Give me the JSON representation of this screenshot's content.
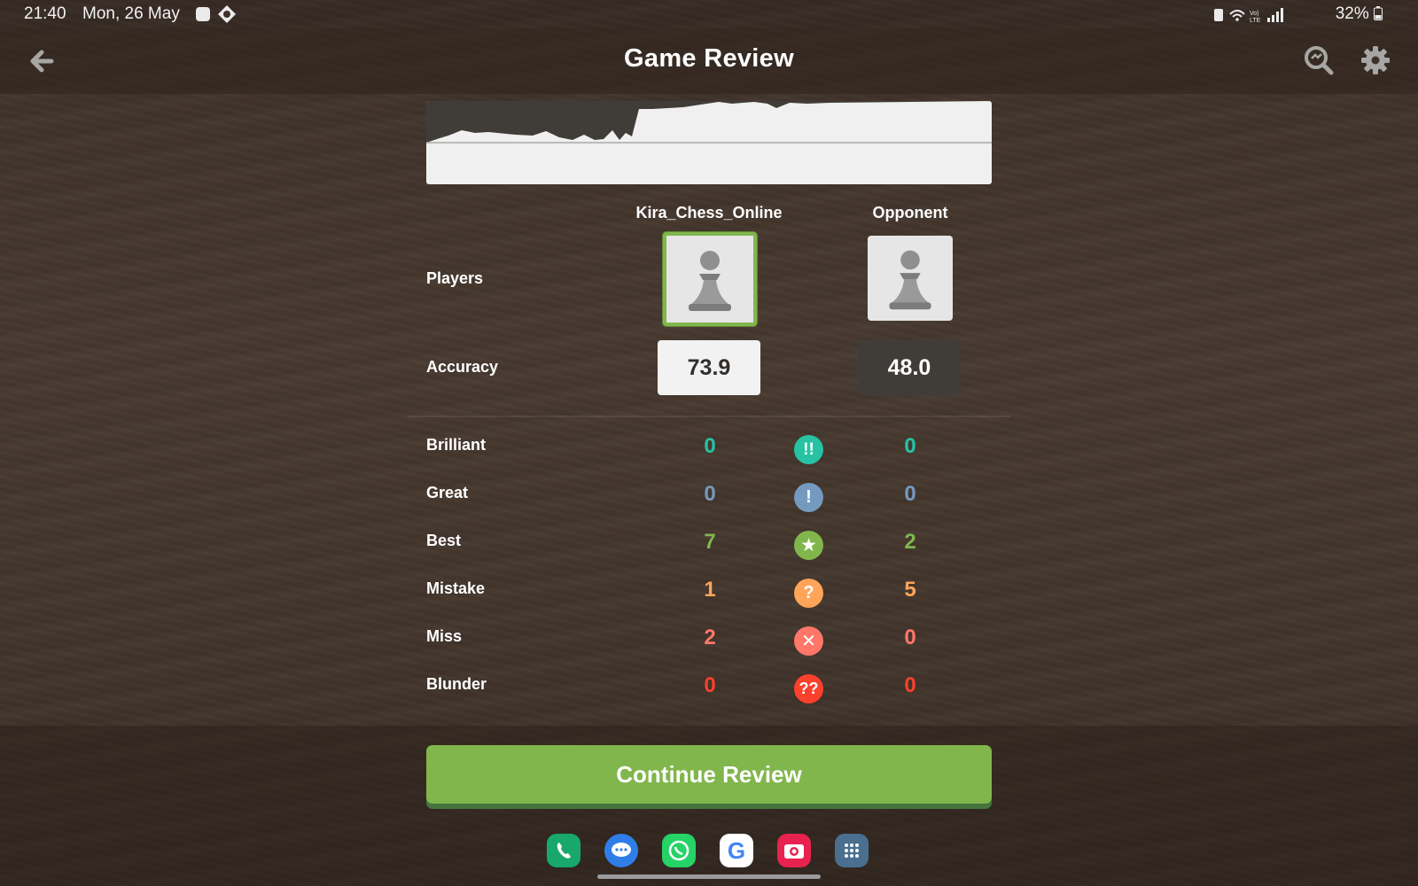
{
  "status_bar": {
    "time": "21:40",
    "date": "Mon, 26 May",
    "battery": "32%"
  },
  "header": {
    "title": "Game Review",
    "back_icon": "arrow-left-icon",
    "search_icon": "zoom-search-icon",
    "settings_icon": "gear-icon"
  },
  "players": {
    "row_label": "Players",
    "white": {
      "name": "Kira_Chess_Online",
      "avatar_icon": "pawn-icon",
      "accuracy": "73.9"
    },
    "black": {
      "name": "Opponent",
      "avatar_icon": "pawn-icon",
      "accuracy": "48.0"
    }
  },
  "accuracy_label": "Accuracy",
  "classifications": [
    {
      "label": "Brilliant",
      "white": "0",
      "black": "0",
      "symbol": "!!",
      "color": "#26c2a3"
    },
    {
      "label": "Great",
      "white": "0",
      "black": "0",
      "symbol": "!",
      "color": "#749bbf"
    },
    {
      "label": "Best",
      "white": "7",
      "black": "2",
      "symbol": "★",
      "color": "#81b64c"
    },
    {
      "label": "Mistake",
      "white": "1",
      "black": "5",
      "symbol": "?",
      "color": "#ffa459"
    },
    {
      "label": "Miss",
      "white": "2",
      "black": "0",
      "symbol": "✕",
      "color": "#ff7769"
    },
    {
      "label": "Blunder",
      "white": "0",
      "black": "0",
      "symbol": "??",
      "color": "#fa412d"
    }
  ],
  "continue_button": "Continue Review",
  "dock": [
    {
      "name": "phone-app-icon",
      "color": "#18a86b"
    },
    {
      "name": "messages-app-icon",
      "color": "#2f7ee8"
    },
    {
      "name": "whatsapp-app-icon",
      "color": "#25d366"
    },
    {
      "name": "google-app-icon",
      "color": "#ffffff"
    },
    {
      "name": "camera-app-icon",
      "color": "#e8224f"
    },
    {
      "name": "app-drawer-icon",
      "color": "#4a6f8f"
    }
  ]
}
